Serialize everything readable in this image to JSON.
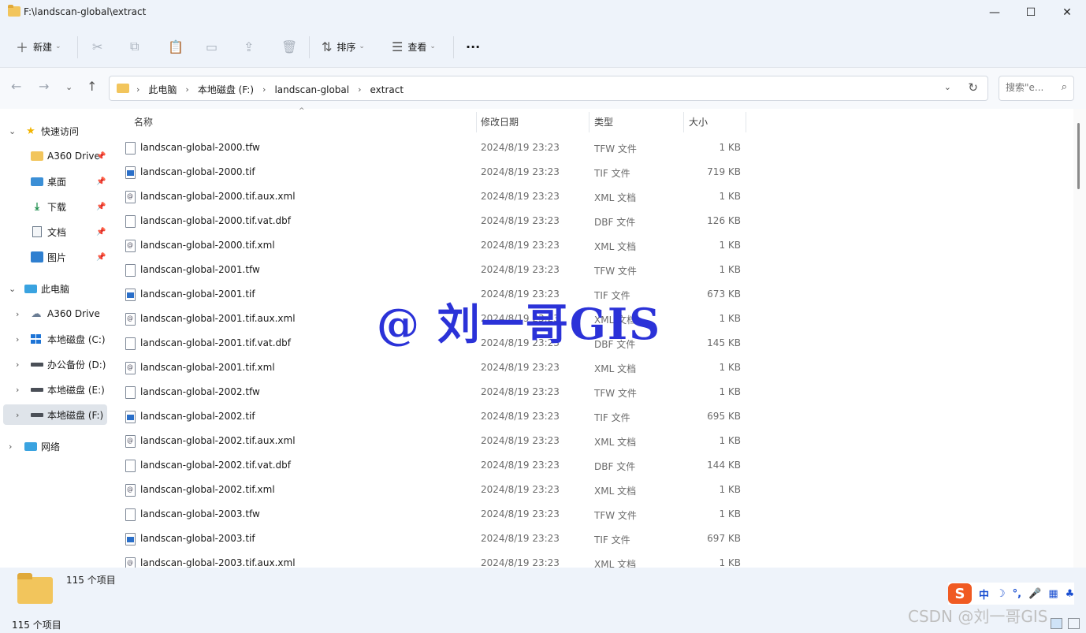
{
  "window": {
    "title": "F:\\landscan-global\\extract"
  },
  "window_controls": {
    "minimize": "—",
    "maximize": "☐",
    "close": "✕"
  },
  "toolbar": {
    "new_label": "新建",
    "sort_label": "排序",
    "view_label": "查看",
    "more_label": "···",
    "icons": {
      "new": "＋",
      "cut": "✂",
      "copy": "⧉",
      "paste": "📋",
      "rename": "▭",
      "share": "⇪",
      "delete": "🗑",
      "sort": "⇅",
      "view": "☰"
    }
  },
  "navigation": {
    "back": "←",
    "forward": "→",
    "recent": "⌄",
    "up": "↑"
  },
  "address": {
    "crumbs": [
      "此电脑",
      "本地磁盘 (F:)",
      "landscan-global",
      "extract"
    ],
    "sep": "›",
    "dropdown": "⌄",
    "refresh": "↻"
  },
  "search": {
    "placeholder": "搜索\"e...",
    "icon": "⌕"
  },
  "sidebar": {
    "quick_access": "快速访问",
    "quick_items": [
      {
        "label": "A360 Drive",
        "icon": "folder-icon"
      },
      {
        "label": "桌面",
        "icon": "desktop-icon"
      },
      {
        "label": "下载",
        "icon": "download-icon"
      },
      {
        "label": "文档",
        "icon": "document-icon"
      },
      {
        "label": "图片",
        "icon": "pictures-icon"
      }
    ],
    "this_pc": "此电脑",
    "pc_items": [
      {
        "label": "A360 Drive",
        "icon": "cloud-drive-icon"
      },
      {
        "label": "本地磁盘 (C:)",
        "icon": "windows-drive-icon"
      },
      {
        "label": "办公备份 (D:)",
        "icon": "drive-icon"
      },
      {
        "label": "本地磁盘 (E:)",
        "icon": "drive-icon"
      },
      {
        "label": "本地磁盘 (F:)",
        "icon": "drive-icon",
        "selected": true
      }
    ],
    "network": "网络",
    "pin": "📌",
    "expand": "›",
    "collapse": "⌄"
  },
  "columns": {
    "name": "名称",
    "date": "修改日期",
    "type": "类型",
    "size": "大小",
    "sort_indicator": "^"
  },
  "files": [
    {
      "name": "landscan-global-2000.tfw",
      "date": "2024/8/19 23:23",
      "type": "TFW 文件",
      "size": "1 KB",
      "kind": "file"
    },
    {
      "name": "landscan-global-2000.tif",
      "date": "2024/8/19 23:23",
      "type": "TIF 文件",
      "size": "719 KB",
      "kind": "tif"
    },
    {
      "name": "landscan-global-2000.tif.aux.xml",
      "date": "2024/8/19 23:23",
      "type": "XML 文档",
      "size": "1 KB",
      "kind": "xml"
    },
    {
      "name": "landscan-global-2000.tif.vat.dbf",
      "date": "2024/8/19 23:23",
      "type": "DBF 文件",
      "size": "126 KB",
      "kind": "file"
    },
    {
      "name": "landscan-global-2000.tif.xml",
      "date": "2024/8/19 23:23",
      "type": "XML 文档",
      "size": "1 KB",
      "kind": "xml"
    },
    {
      "name": "landscan-global-2001.tfw",
      "date": "2024/8/19 23:23",
      "type": "TFW 文件",
      "size": "1 KB",
      "kind": "file"
    },
    {
      "name": "landscan-global-2001.tif",
      "date": "2024/8/19 23:23",
      "type": "TIF 文件",
      "size": "673 KB",
      "kind": "tif"
    },
    {
      "name": "landscan-global-2001.tif.aux.xml",
      "date": "2024/8/19 23:23",
      "type": "XML 文档",
      "size": "1 KB",
      "kind": "xml"
    },
    {
      "name": "landscan-global-2001.tif.vat.dbf",
      "date": "2024/8/19 23:23",
      "type": "DBF 文件",
      "size": "145 KB",
      "kind": "file"
    },
    {
      "name": "landscan-global-2001.tif.xml",
      "date": "2024/8/19 23:23",
      "type": "XML 文档",
      "size": "1 KB",
      "kind": "xml"
    },
    {
      "name": "landscan-global-2002.tfw",
      "date": "2024/8/19 23:23",
      "type": "TFW 文件",
      "size": "1 KB",
      "kind": "file"
    },
    {
      "name": "landscan-global-2002.tif",
      "date": "2024/8/19 23:23",
      "type": "TIF 文件",
      "size": "695 KB",
      "kind": "tif"
    },
    {
      "name": "landscan-global-2002.tif.aux.xml",
      "date": "2024/8/19 23:23",
      "type": "XML 文档",
      "size": "1 KB",
      "kind": "xml"
    },
    {
      "name": "landscan-global-2002.tif.vat.dbf",
      "date": "2024/8/19 23:23",
      "type": "DBF 文件",
      "size": "144 KB",
      "kind": "file"
    },
    {
      "name": "landscan-global-2002.tif.xml",
      "date": "2024/8/19 23:23",
      "type": "XML 文档",
      "size": "1 KB",
      "kind": "xml"
    },
    {
      "name": "landscan-global-2003.tfw",
      "date": "2024/8/19 23:23",
      "type": "TFW 文件",
      "size": "1 KB",
      "kind": "file"
    },
    {
      "name": "landscan-global-2003.tif",
      "date": "2024/8/19 23:23",
      "type": "TIF 文件",
      "size": "697 KB",
      "kind": "tif"
    },
    {
      "name": "landscan-global-2003.tif.aux.xml",
      "date": "2024/8/19 23:23",
      "type": "XML 文档",
      "size": "1 KB",
      "kind": "xml"
    }
  ],
  "details": {
    "item_count": "115 个项目"
  },
  "status": {
    "item_count": "115 个项目"
  },
  "overlays": {
    "watermark": "@ 刘一哥GIS",
    "ime": {
      "logo": "S",
      "items": [
        "中",
        "☽",
        "°,",
        "🎤",
        "▦",
        "♣"
      ]
    },
    "csdn": "CSDN @刘一哥GIS"
  },
  "colors": {
    "accent": "#1d74d6",
    "folder": "#f2c55c",
    "watermark": "#2b32d8",
    "chrome": "#eef3fa"
  }
}
